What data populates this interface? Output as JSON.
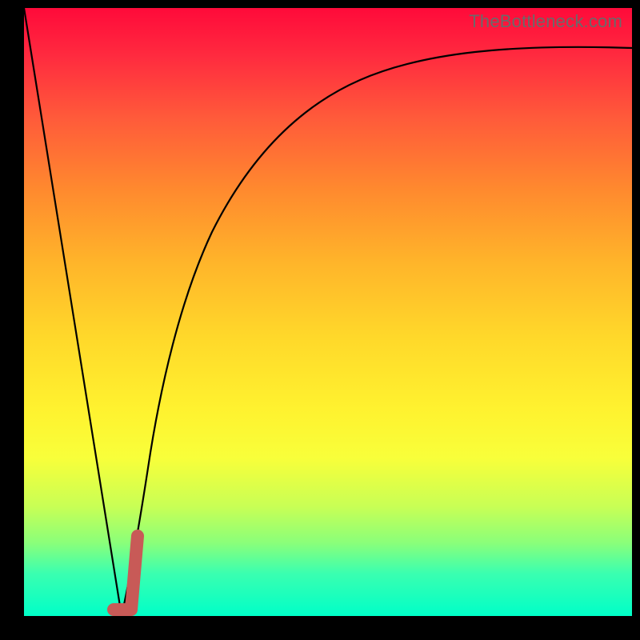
{
  "watermark": "TheBottleneck.com",
  "chart_data": {
    "type": "line",
    "title": "",
    "xlabel": "",
    "ylabel": "",
    "xlim": [
      0,
      100
    ],
    "ylim": [
      0,
      100
    ],
    "grid": false,
    "series": [
      {
        "name": "left-slope",
        "x": [
          0,
          16
        ],
        "y": [
          100,
          0
        ]
      },
      {
        "name": "right-curve",
        "x": [
          16,
          20,
          24,
          28,
          34,
          42,
          52,
          64,
          80,
          100
        ],
        "y": [
          0,
          24,
          42,
          55,
          67,
          76,
          83,
          88,
          91,
          93
        ]
      }
    ],
    "annotations": [
      {
        "name": "optimal-marker",
        "shape": "J",
        "color": "#c85a57",
        "approx_x": [
          15,
          18.5
        ],
        "approx_y": [
          0,
          14
        ]
      }
    ],
    "background_gradient": {
      "top": "#ff0a3a",
      "bottom": "#00ffc8"
    }
  }
}
